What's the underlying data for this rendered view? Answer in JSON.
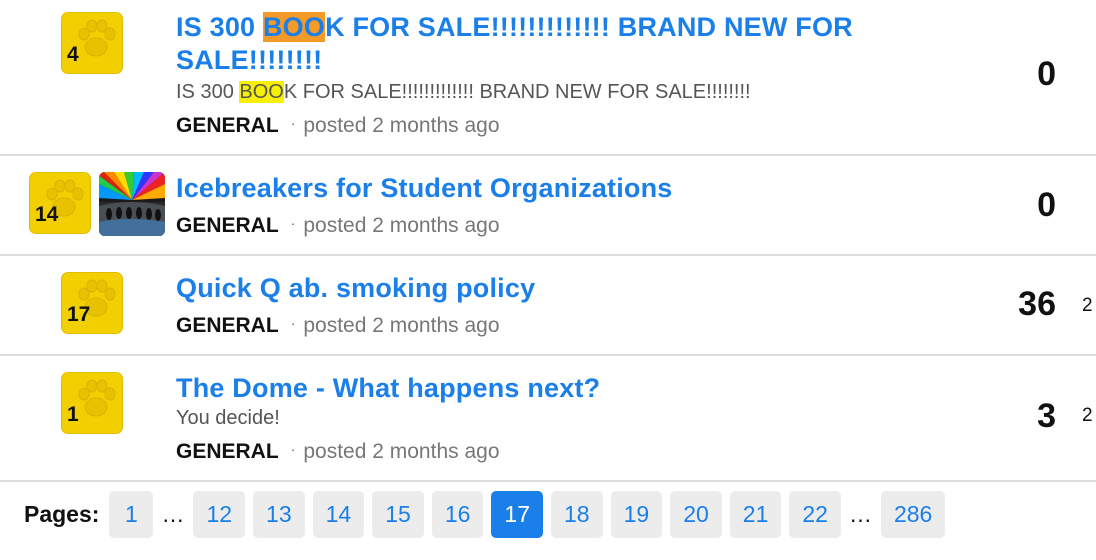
{
  "posts": [
    {
      "votes": "4",
      "title_pre": "IS 300 ",
      "title_hl": "BOO",
      "title_post": "K FOR SALE!!!!!!!!!!!!! BRAND NEW FOR SALE!!!!!!!!",
      "excerpt_pre": "IS 300 ",
      "excerpt_hl": "BOO",
      "excerpt_post": "K FOR SALE!!!!!!!!!!!!! BRAND NEW FOR SALE!!!!!!!!",
      "category": "GENERAL",
      "posted": "posted 2 months ago",
      "count": "0",
      "extra": ""
    },
    {
      "votes": "14",
      "title": "Icebreakers for Student Organizations",
      "category": "GENERAL",
      "posted": "posted 2 months ago",
      "count": "0",
      "extra": ""
    },
    {
      "votes": "17",
      "title": "Quick Q ab. smoking policy",
      "category": "GENERAL",
      "posted": "posted 2 months ago",
      "count": "36",
      "extra": "2"
    },
    {
      "votes": "1",
      "title": "The Dome - What happens next?",
      "excerpt": "You decide!",
      "category": "GENERAL",
      "posted": "posted 2 months ago",
      "count": "3",
      "extra": "2"
    }
  ],
  "meta_separator": "·",
  "pagination": {
    "label": "Pages:",
    "pages": [
      "1",
      "12",
      "13",
      "14",
      "15",
      "16",
      "17",
      "18",
      "19",
      "20",
      "21",
      "22",
      "286"
    ],
    "ellipsis": "…",
    "current": "17"
  },
  "colors": {
    "link": "#1a7fe8",
    "vote_box": "#f2cf00",
    "highlight_title": "#f39a28",
    "highlight_excerpt": "#f7f000"
  },
  "icons": {
    "vote": "paw-icon"
  }
}
